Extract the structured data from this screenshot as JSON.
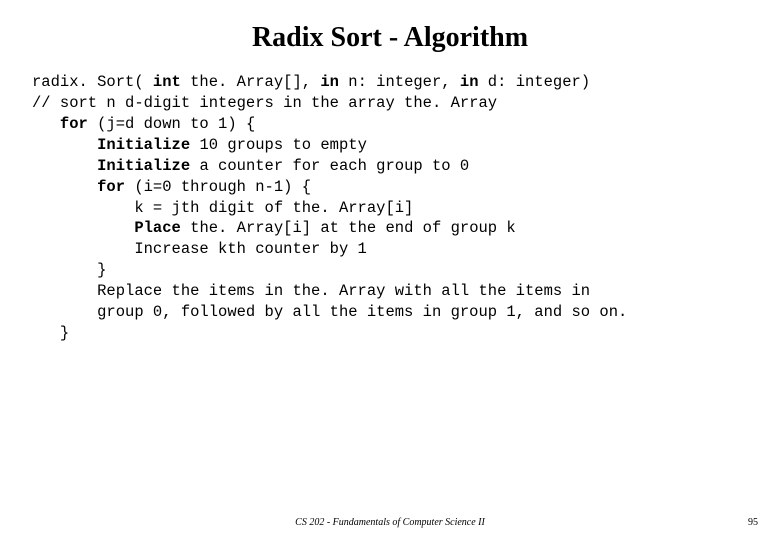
{
  "title": "Radix Sort - Algorithm",
  "code": {
    "l1a": "radix. Sort( ",
    "l1b": "int",
    "l1c": " the. Array[], ",
    "l1d": "in",
    "l1e": " n: integer, ",
    "l1f": "in",
    "l1g": " d: integer)",
    "l2": "// sort n d-digit integers in the array the. Array",
    "l3a": "   ",
    "l3b": "for",
    "l3c": " (j=d down to 1) {",
    "l4a": "       ",
    "l4b": "Initialize",
    "l4c": " 10 groups to empty",
    "l5a": "       ",
    "l5b": "Initialize",
    "l5c": " a counter for each group to 0",
    "l6a": "       ",
    "l6b": "for",
    "l6c": " (i=0 through n-1) {",
    "l7": "           k = jth digit of the. Array[i]",
    "l8a": "           ",
    "l8b": "Place",
    "l8c": " the. Array[i] at the end of group k",
    "l9": "           Increase kth counter by 1",
    "l10": "       }",
    "l11": "       Replace the items in the. Array with all the items in",
    "l12": "       group 0, followed by all the items in group 1, and so on.",
    "l13": "   }"
  },
  "footer": {
    "center": "CS 202 - Fundamentals of Computer Science II",
    "page": "95"
  }
}
